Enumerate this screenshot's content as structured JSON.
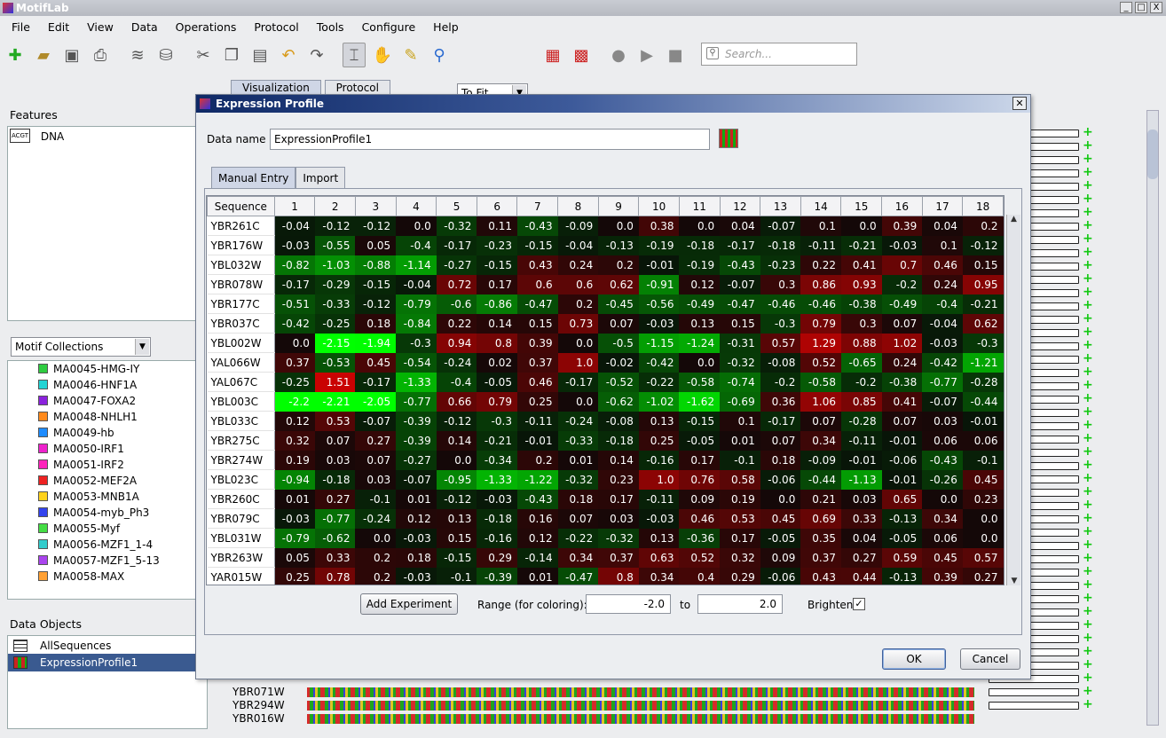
{
  "app": {
    "title": "MotifLab"
  },
  "window_controls": {
    "min": "_",
    "max": "□",
    "close": "X"
  },
  "menu": [
    "File",
    "Edit",
    "View",
    "Data",
    "Operations",
    "Protocol",
    "Tools",
    "Configure",
    "Help"
  ],
  "toolbar": {
    "zoom": "To Fit",
    "search_placeholder": "Search..."
  },
  "main_tabs": [
    "Visualization",
    "Protocol"
  ],
  "features": {
    "title": "Features",
    "items": [
      {
        "icon_text": "ACGT",
        "label": "DNA"
      }
    ]
  },
  "motif_collections": {
    "selector": "Motif Collections",
    "items": [
      {
        "label": "MA0045-HMG-IY",
        "color": "#2ecc40"
      },
      {
        "label": "MA0046-HNF1A",
        "color": "#22d4d4"
      },
      {
        "label": "MA0047-FOXA2",
        "color": "#8b22dd"
      },
      {
        "label": "MA0048-NHLH1",
        "color": "#ff8a1c"
      },
      {
        "label": "MA0049-hb",
        "color": "#1e8cff"
      },
      {
        "label": "MA0050-IRF1",
        "color": "#ee22cc"
      },
      {
        "label": "MA0051-IRF2",
        "color": "#ff22bb"
      },
      {
        "label": "MA0052-MEF2A",
        "color": "#ee2222"
      },
      {
        "label": "MA0053-MNB1A",
        "color": "#ffd21c"
      },
      {
        "label": "MA0054-myb_Ph3",
        "color": "#3344ee"
      },
      {
        "label": "MA0055-Myf",
        "color": "#44dd44"
      },
      {
        "label": "MA0056-MZF1_1-4",
        "color": "#33cccc"
      },
      {
        "label": "MA0057-MZF1_5-13",
        "color": "#aa44ee"
      },
      {
        "label": "MA0058-MAX",
        "color": "#ffa033"
      }
    ]
  },
  "data_objects": {
    "title": "Data Objects",
    "items": [
      {
        "label": "AllSequences"
      },
      {
        "label": "ExpressionProfile1"
      }
    ]
  },
  "background_sequences": [
    "YBR071W",
    "YBR294W",
    "YBR016W"
  ],
  "dialog": {
    "title": "Expression Profile",
    "data_name_label": "Data name",
    "data_name_value": "ExpressionProfile1",
    "tabs": [
      "Manual Entry",
      "Import"
    ],
    "table": {
      "header_seq": "Sequence",
      "columns": [
        "1",
        "2",
        "3",
        "4",
        "5",
        "6",
        "7",
        "8",
        "9",
        "10",
        "11",
        "12",
        "13",
        "14",
        "15",
        "16",
        "17",
        "18"
      ],
      "rows": [
        {
          "seq": "YBR261C",
          "v": [
            "-0.04",
            "-0.12",
            "-0.12",
            "0.0",
            "-0.32",
            "0.11",
            "-0.43",
            "-0.09",
            "0.0",
            "0.38",
            "0.0",
            "0.04",
            "-0.07",
            "0.1",
            "0.0",
            "0.39",
            "0.04",
            "0.2"
          ]
        },
        {
          "seq": "YBR176W",
          "v": [
            "-0.03",
            "-0.55",
            "0.05",
            "-0.4",
            "-0.17",
            "-0.23",
            "-0.15",
            "-0.04",
            "-0.13",
            "-0.19",
            "-0.18",
            "-0.17",
            "-0.18",
            "-0.11",
            "-0.21",
            "-0.03",
            "0.1",
            "-0.12"
          ]
        },
        {
          "seq": "YBL032W",
          "v": [
            "-0.82",
            "-1.03",
            "-0.88",
            "-1.14",
            "-0.27",
            "-0.15",
            "0.43",
            "0.24",
            "0.2",
            "-0.01",
            "-0.19",
            "-0.43",
            "-0.23",
            "0.22",
            "0.41",
            "0.7",
            "0.46",
            "0.15"
          ]
        },
        {
          "seq": "YBR078W",
          "v": [
            "-0.17",
            "-0.29",
            "-0.15",
            "-0.04",
            "0.72",
            "0.17",
            "0.6",
            "0.6",
            "0.62",
            "-0.91",
            "0.12",
            "-0.07",
            "0.3",
            "0.86",
            "0.93",
            "-0.2",
            "0.24",
            "0.95"
          ]
        },
        {
          "seq": "YBR177C",
          "v": [
            "-0.51",
            "-0.33",
            "-0.12",
            "-0.79",
            "-0.6",
            "-0.86",
            "-0.47",
            "0.2",
            "-0.45",
            "-0.56",
            "-0.49",
            "-0.47",
            "-0.46",
            "-0.46",
            "-0.38",
            "-0.49",
            "-0.4",
            "-0.21"
          ]
        },
        {
          "seq": "YBR037C",
          "v": [
            "-0.42",
            "-0.25",
            "0.18",
            "-0.84",
            "0.22",
            "0.14",
            "0.15",
            "0.73",
            "0.07",
            "-0.03",
            "0.13",
            "0.15",
            "-0.3",
            "0.79",
            "0.3",
            "0.07",
            "-0.04",
            "0.62"
          ]
        },
        {
          "seq": "YBL002W",
          "v": [
            "0.0",
            "-2.15",
            "-1.94",
            "-0.3",
            "0.94",
            "0.8",
            "0.39",
            "0.0",
            "-0.5",
            "-1.15",
            "-1.24",
            "-0.31",
            "0.57",
            "1.29",
            "0.88",
            "1.02",
            "-0.03",
            "-0.3"
          ]
        },
        {
          "seq": "YAL066W",
          "v": [
            "0.37",
            "-0.53",
            "0.45",
            "-0.54",
            "-0.24",
            "0.02",
            "0.37",
            "1.0",
            "-0.02",
            "-0.42",
            "0.0",
            "-0.32",
            "-0.08",
            "0.52",
            "-0.65",
            "0.24",
            "-0.42",
            "-1.21"
          ]
        },
        {
          "seq": "YAL067C",
          "v": [
            "-0.25",
            "1.51",
            "-0.17",
            "-1.33",
            "-0.4",
            "-0.05",
            "0.46",
            "-0.17",
            "-0.52",
            "-0.22",
            "-0.58",
            "-0.74",
            "-0.2",
            "-0.58",
            "-0.2",
            "-0.38",
            "-0.77",
            "-0.28"
          ]
        },
        {
          "seq": "YBL003C",
          "v": [
            "-2.2",
            "-2.21",
            "-2.05",
            "-0.77",
            "0.66",
            "0.79",
            "0.25",
            "0.0",
            "-0.62",
            "-1.02",
            "-1.62",
            "-0.69",
            "0.36",
            "1.06",
            "0.85",
            "0.41",
            "-0.07",
            "-0.44"
          ]
        },
        {
          "seq": "YBL033C",
          "v": [
            "0.12",
            "0.53",
            "-0.07",
            "-0.39",
            "-0.12",
            "-0.3",
            "-0.11",
            "-0.24",
            "-0.08",
            "0.13",
            "-0.15",
            "0.1",
            "-0.17",
            "0.07",
            "-0.28",
            "0.07",
            "0.03",
            "-0.01"
          ]
        },
        {
          "seq": "YBR275C",
          "v": [
            "0.32",
            "0.07",
            "0.27",
            "-0.39",
            "0.14",
            "-0.21",
            "-0.01",
            "-0.33",
            "-0.18",
            "0.25",
            "-0.05",
            "0.01",
            "0.07",
            "0.34",
            "-0.11",
            "-0.01",
            "0.06",
            "0.06"
          ]
        },
        {
          "seq": "YBR274W",
          "v": [
            "0.19",
            "0.03",
            "0.07",
            "-0.27",
            "0.0",
            "-0.34",
            "0.2",
            "0.01",
            "0.14",
            "-0.16",
            "0.17",
            "-0.1",
            "0.18",
            "-0.09",
            "-0.01",
            "-0.06",
            "-0.43",
            "-0.1"
          ]
        },
        {
          "seq": "YBL023C",
          "v": [
            "-0.94",
            "-0.18",
            "0.03",
            "-0.07",
            "-0.95",
            "-1.33",
            "-1.22",
            "-0.32",
            "0.23",
            "1.0",
            "0.76",
            "0.58",
            "-0.06",
            "-0.44",
            "-1.13",
            "-0.01",
            "-0.26",
            "0.45"
          ]
        },
        {
          "seq": "YBR260C",
          "v": [
            "0.01",
            "0.27",
            "-0.1",
            "0.01",
            "-0.12",
            "-0.03",
            "-0.43",
            "0.18",
            "0.17",
            "-0.11",
            "0.09",
            "0.19",
            "0.0",
            "0.21",
            "0.03",
            "0.65",
            "0.0",
            "0.23"
          ]
        },
        {
          "seq": "YBR079C",
          "v": [
            "-0.03",
            "-0.77",
            "-0.24",
            "0.12",
            "0.13",
            "-0.18",
            "0.16",
            "0.07",
            "0.03",
            "-0.03",
            "0.46",
            "0.53",
            "0.45",
            "0.69",
            "0.33",
            "-0.13",
            "0.34",
            "0.0"
          ]
        },
        {
          "seq": "YBL031W",
          "v": [
            "-0.79",
            "-0.62",
            "0.0",
            "-0.03",
            "0.15",
            "-0.16",
            "0.12",
            "-0.22",
            "-0.32",
            "0.13",
            "-0.36",
            "0.17",
            "-0.05",
            "0.35",
            "0.04",
            "-0.05",
            "0.06",
            "0.0"
          ]
        },
        {
          "seq": "YBR263W",
          "v": [
            "0.05",
            "0.33",
            "0.2",
            "0.18",
            "-0.15",
            "0.29",
            "-0.14",
            "0.34",
            "0.37",
            "0.63",
            "0.52",
            "0.32",
            "0.09",
            "0.37",
            "0.27",
            "0.59",
            "0.45",
            "0.57"
          ]
        },
        {
          "seq": "YAR015W",
          "v": [
            "0.25",
            "0.78",
            "0.2",
            "-0.03",
            "-0.1",
            "-0.39",
            "0.01",
            "-0.47",
            "0.8",
            "0.34",
            "0.4",
            "0.29",
            "-0.06",
            "0.43",
            "0.44",
            "-0.13",
            "0.39",
            "0.27"
          ]
        }
      ]
    },
    "add_experiment": "Add Experiment",
    "range_label": "Range (for coloring):",
    "range_min": "-2.0",
    "range_to": "to",
    "range_max": "2.0",
    "brighten_label": "Brighten",
    "brighten_checked": true,
    "ok": "OK",
    "cancel": "Cancel"
  }
}
